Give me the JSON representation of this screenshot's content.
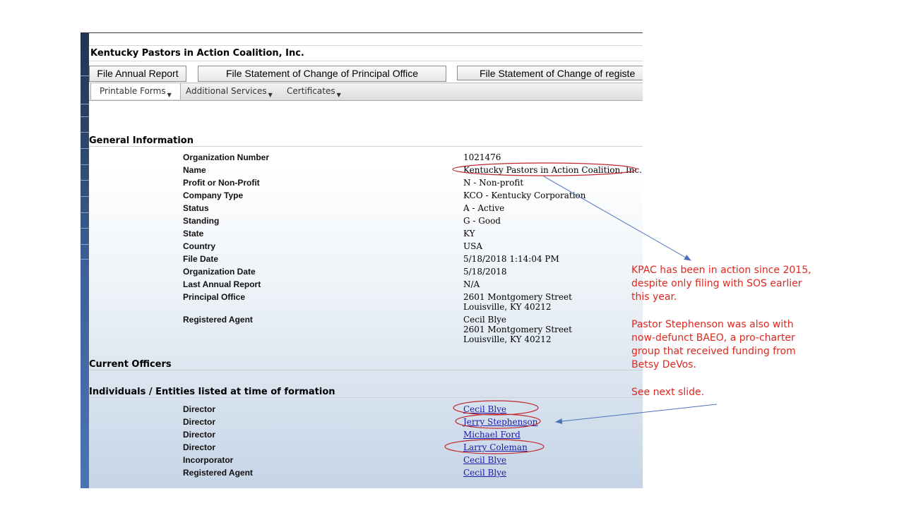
{
  "org_title": "Kentucky Pastors in Action Coalition, Inc.",
  "buttons": [
    "File Annual Report",
    "File Statement of Change of Principal Office",
    "File Statement of Change of registe"
  ],
  "menus": [
    "Printable Forms",
    "Additional Services",
    "Certificates"
  ],
  "sections": {
    "general": "General Information",
    "officers": "Current Officers",
    "formation": "Individuals / Entities listed at time of formation"
  },
  "general_info": [
    {
      "label": "Organization Number",
      "value": "1021476"
    },
    {
      "label": "Name",
      "value": "Kentucky Pastors in Action Coalition, Inc."
    },
    {
      "label": "Profit or Non-Profit",
      "value": "N - Non-profit"
    },
    {
      "label": "Company Type",
      "value": "KCO - Kentucky Corporation"
    },
    {
      "label": "Status",
      "value": "A - Active"
    },
    {
      "label": "Standing",
      "value": "G - Good"
    },
    {
      "label": "State",
      "value": "KY"
    },
    {
      "label": "Country",
      "value": "USA"
    },
    {
      "label": "File Date",
      "value": "5/18/2018 1:14:04 PM"
    },
    {
      "label": "Organization Date",
      "value": "5/18/2018"
    },
    {
      "label": "Last Annual Report",
      "value": "N/A"
    },
    {
      "label": "Principal Office",
      "lines": [
        "2601 Montgomery Street",
        "Louisville, KY 40212"
      ]
    },
    {
      "label": "Registered Agent",
      "lines": [
        "Cecil Blye",
        "2601 Montgomery Street",
        "Louisville, KY 40212"
      ]
    }
  ],
  "formation": [
    {
      "role": "Director",
      "name": "Cecil Blye"
    },
    {
      "role": "Director",
      "name": "Jerry Stephenson"
    },
    {
      "role": "Director",
      "name": "Michael Ford"
    },
    {
      "role": "Director",
      "name": "Larry Coleman"
    },
    {
      "role": "Incorporator",
      "name": "Cecil Blye"
    },
    {
      "role": "Registered Agent",
      "name": "Cecil Blye"
    }
  ],
  "annotations": {
    "note1": [
      "KPAC has been in action since 2015,",
      "despite only filing with SOS earlier",
      "this year."
    ],
    "note2": [
      "Pastor Stephenson was also with",
      "now-defunct  BAEO, a pro-charter",
      "group that received funding from",
      "Betsy DeVos."
    ],
    "note3": "See next slide."
  },
  "colors": {
    "annotation": "#e0271f",
    "arrow": "#4a72b8",
    "link": "#1a1aa6"
  }
}
